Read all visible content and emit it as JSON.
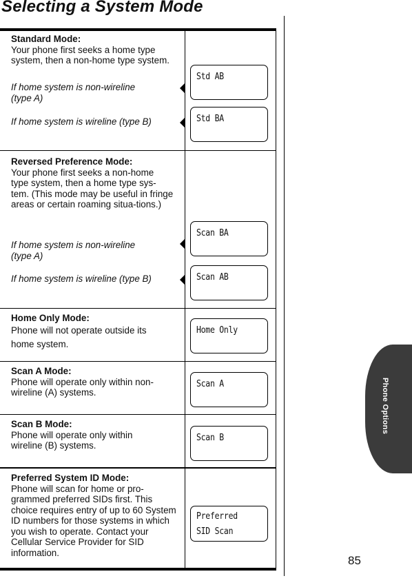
{
  "page": {
    "title": "Selecting a System Mode",
    "page_number": "85",
    "side_tab": "Phone Options"
  },
  "modes": [
    {
      "heading": "Standard Mode:",
      "body": "Your phone first seeks a home type system, then a non-home type system.",
      "options": [
        {
          "condition": "If home system is non-wireline (type A)",
          "display": "Std AB"
        },
        {
          "condition": "If home system is wireline (type B)",
          "display": "Std BA"
        }
      ]
    },
    {
      "heading": "Reversed Preference Mode:",
      "body": "Your phone first seeks a non-home type system, then a home type sys-tem. (This mode may be useful in fringe areas or certain roaming situa-tions.)",
      "options": [
        {
          "condition": "If home system is non-wireline (type A)",
          "display": "Scan BA"
        },
        {
          "condition": "If home system is wireline (type B)",
          "display": "Scan AB"
        }
      ]
    },
    {
      "heading": "Home Only Mode:",
      "body": "Phone will not operate outside its home system.",
      "display": "Home Only"
    },
    {
      "heading": "Scan A Mode:",
      "body": "Phone will operate only within non-wireline (A) systems.",
      "display": "Scan A"
    },
    {
      "heading": "Scan B Mode:",
      "body": "Phone will operate only within wireline (B) systems.",
      "display": "Scan B"
    },
    {
      "heading": "Preferred System ID Mode:",
      "body": "Phone will scan for home or pro-grammed preferred SIDs first. This choice requires entry of up to 60 System ID numbers for those systems in which you wish to operate. Contact your Cellular Service Provider for SID information.",
      "display": "Preferred\nSID Scan"
    }
  ]
}
